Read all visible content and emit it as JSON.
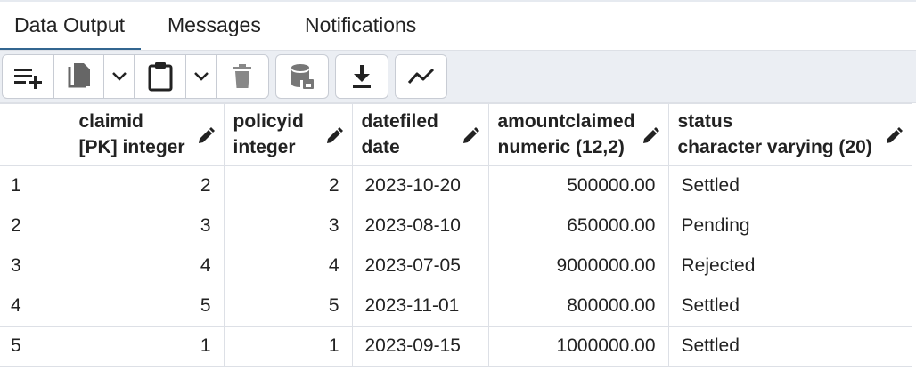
{
  "tabs": [
    {
      "label": "Data Output",
      "active": true
    },
    {
      "label": "Messages",
      "active": false
    },
    {
      "label": "Notifications",
      "active": false
    }
  ],
  "toolbar": {
    "buttons": [
      {
        "icon": "add-row-icon"
      },
      {
        "icon": "copy-icon"
      },
      {
        "icon": "chevron-down-icon"
      },
      {
        "icon": "paste-icon"
      },
      {
        "icon": "chevron-down-icon"
      },
      {
        "icon": "delete-icon"
      },
      {
        "icon": "save-data-icon"
      },
      {
        "icon": "download-icon"
      },
      {
        "icon": "graph-visualiser-icon"
      }
    ]
  },
  "grid": {
    "columns": [
      {
        "name": "claimid",
        "type": "[PK] integer"
      },
      {
        "name": "policyid",
        "type": "integer"
      },
      {
        "name": "datefiled",
        "type": "date"
      },
      {
        "name": "amountclaimed",
        "type": "numeric (12,2)"
      },
      {
        "name": "status",
        "type": "character varying (20)"
      }
    ],
    "rows": [
      {
        "num": "1",
        "cells": [
          "2",
          "2",
          "2023-10-20",
          "500000.00",
          "Settled"
        ]
      },
      {
        "num": "2",
        "cells": [
          "3",
          "3",
          "2023-08-10",
          "650000.00",
          "Pending"
        ]
      },
      {
        "num": "3",
        "cells": [
          "4",
          "4",
          "2023-07-05",
          "9000000.00",
          "Rejected"
        ]
      },
      {
        "num": "4",
        "cells": [
          "5",
          "5",
          "2023-11-01",
          "800000.00",
          "Settled"
        ]
      },
      {
        "num": "5",
        "cells": [
          "1",
          "1",
          "2023-09-15",
          "1000000.00",
          "Settled"
        ]
      }
    ]
  },
  "colors": {
    "active_tab_underline": "#326690",
    "toolbar_background": "#ebeef3",
    "grid_border": "#dde0e6"
  }
}
